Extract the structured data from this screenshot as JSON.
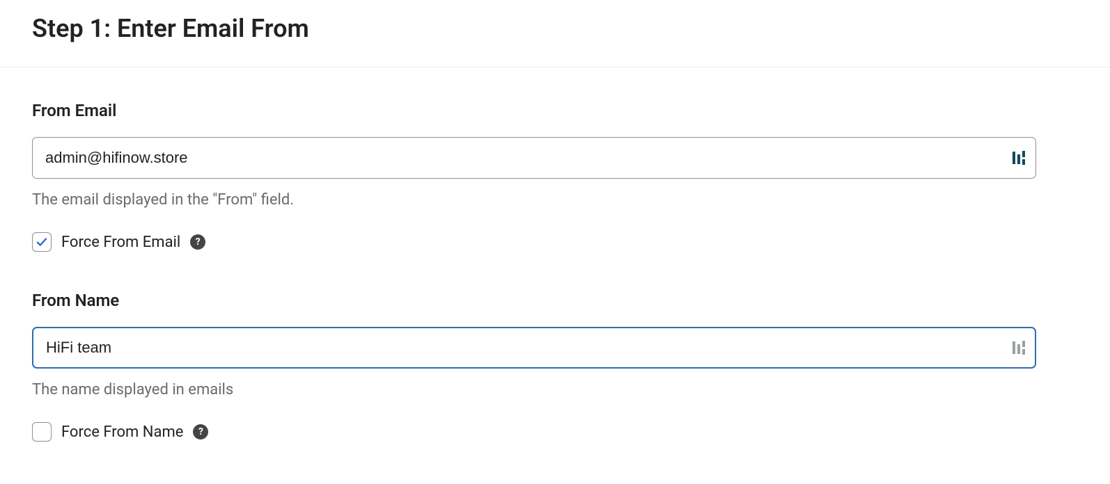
{
  "header": {
    "title": "Step 1: Enter Email From"
  },
  "from_email": {
    "label": "From Email",
    "value": "admin@hifinow.store",
    "helper": "The email displayed in the \"From\" field.",
    "force_label": "Force From Email",
    "force_checked": true,
    "suffix_icon": "dashlane-icon",
    "suffix_icon_color": "#0e4a5a",
    "help_icon_glyph": "?"
  },
  "from_name": {
    "label": "From Name",
    "value": "HiFi team",
    "helper": "The name displayed in emails",
    "force_label": "Force From Name",
    "force_checked": false,
    "focused": true,
    "suffix_icon": "dashlane-icon",
    "suffix_icon_color": "#9aa0a3",
    "help_icon_glyph": "?"
  }
}
